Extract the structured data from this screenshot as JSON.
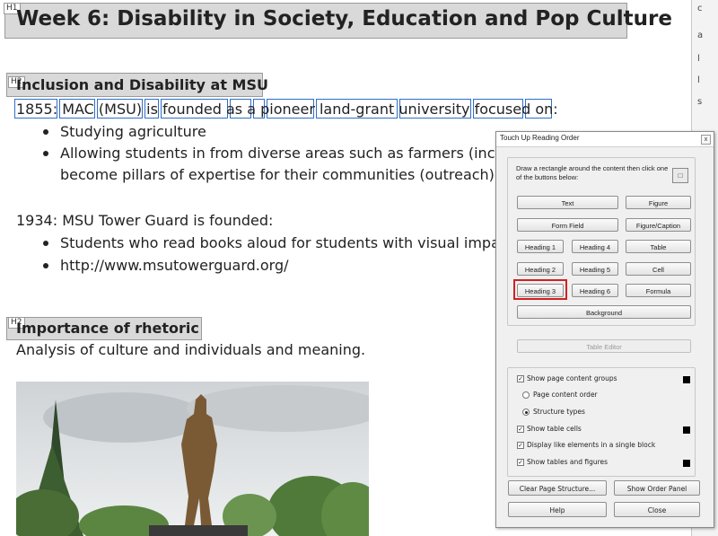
{
  "document": {
    "h1": {
      "tag": "H1",
      "text": "Week 6: Disability in Society, Education and Pop Culture"
    },
    "h2_first": {
      "tag": "H2",
      "text": "Inclusion and Disability at MSU"
    },
    "line_1855": "1855: MAC (MSU) is founded as a pioneer land-grant university focused on:",
    "bullets_1855": [
      "Studying agriculture",
      "Allowing students in from diverse areas such as farmers (inclu",
      "become pillars of expertise for their communities (outreach)"
    ],
    "line_1934": "1934: MSU Tower Guard is founded:",
    "bullets_1934": [
      "Students who read books aloud for students with visual impa",
      "http://www.msutowerguard.org/"
    ],
    "h2_second": {
      "tag": "H2",
      "text": "Importance of rhetoric"
    },
    "rhetoric_text": "Analysis of culture and individuals and meaning."
  },
  "dialog": {
    "title": "Touch Up Reading Order",
    "close": "x",
    "instruction": "Draw a rectangle around the content then click one of the buttons below:",
    "buttons": {
      "text": "Text",
      "figure": "Figure",
      "form_field": "Form Field",
      "figure_caption": "Figure/Caption",
      "heading1": "Heading 1",
      "heading4": "Heading 4",
      "table": "Table",
      "heading2": "Heading 2",
      "heading5": "Heading 5",
      "cell": "Cell",
      "heading3": "Heading 3",
      "heading6": "Heading 6",
      "formula": "Formula",
      "background": "Background",
      "table_editor": "Table Editor",
      "clear_page_structure": "Clear Page Structure...",
      "show_order_panel": "Show Order Panel",
      "help": "Help",
      "close": "Close"
    },
    "options": {
      "show_page_content_groups": "Show page content groups",
      "page_content_order": "Page content order",
      "structure_types": "Structure types",
      "show_table_cells": "Show table cells",
      "display_like_elements": "Display like elements in a single block",
      "show_tables_and_figures": "Show tables and figures"
    }
  },
  "colors": {
    "accent_box": "#2f6fc8",
    "highlight": "#d12020"
  }
}
